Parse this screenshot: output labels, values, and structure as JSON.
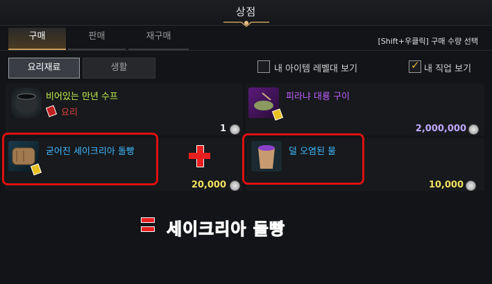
{
  "window": {
    "title": "상점"
  },
  "tabs": [
    {
      "label": "구매",
      "active": true
    },
    {
      "label": "판매",
      "active": false
    },
    {
      "label": "재구매",
      "active": false
    }
  ],
  "hint": "[Shift+우클릭] 구매 수량 선택",
  "subtabs": [
    {
      "label": "요리재료",
      "active": true
    },
    {
      "label": "생활",
      "active": false
    }
  ],
  "options": {
    "level_view": {
      "label": "내 아이템 레벨대 보기",
      "checked": false
    },
    "class_view": {
      "label": "내 직업 보기",
      "checked": true
    }
  },
  "items": [
    {
      "name": "비어있는 만년 수프",
      "subtext": "요리",
      "price": "1",
      "icon": "cauldron-icon",
      "name_color": "#c8f050"
    },
    {
      "name": "피라냐 대룡 구이",
      "price": "2,000,000",
      "icon": "grilled-fish-icon",
      "name_color": "#c060ff"
    },
    {
      "name": "굳어진 세이크리아 돌빵",
      "price": "20,000",
      "icon": "stone-bread-icon",
      "name_color": "#40b8ff"
    },
    {
      "name": "덜 오염된 물",
      "price": "10,000",
      "icon": "cup-icon",
      "name_color": "#40b8ff"
    }
  ],
  "annotation": {
    "plus": "+",
    "equals": "=",
    "result": "세이크리아 돌빵",
    "color": "#e82020"
  }
}
